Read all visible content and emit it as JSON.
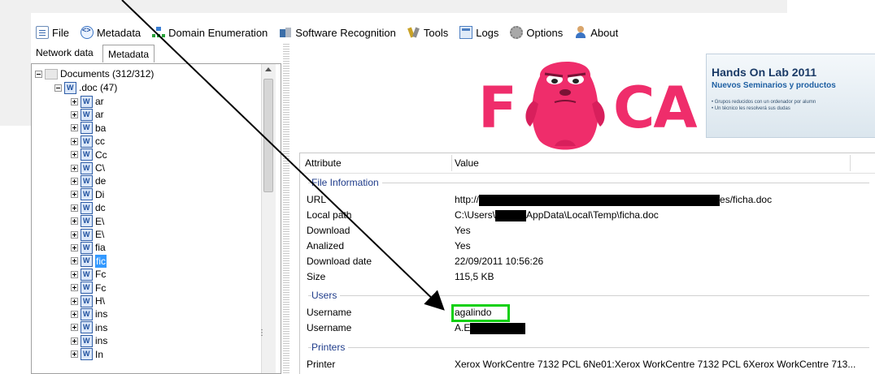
{
  "menu": [
    {
      "label": "File",
      "icon": "file-icon"
    },
    {
      "label": "Metadata",
      "icon": "metadata-icon"
    },
    {
      "label": "Domain Enumeration",
      "icon": "network-icon"
    },
    {
      "label": "Software Recognition",
      "icon": "software-icon"
    },
    {
      "label": "Tools",
      "icon": "tools-icon"
    },
    {
      "label": "Logs",
      "icon": "logs-icon"
    },
    {
      "label": "Options",
      "icon": "gear-icon"
    },
    {
      "label": "About",
      "icon": "user-icon"
    }
  ],
  "tabs": {
    "network": "Network data",
    "metadata": "Metadata"
  },
  "tree": {
    "root": "Documents (312/312)",
    "doc_group": ".doc (47)",
    "items": [
      "ar",
      "ar",
      "ba",
      "cc",
      "Cc",
      "C\\",
      "de",
      "Di",
      "dc",
      "E\\",
      "E\\",
      "fia",
      "fic",
      "Fc",
      "Fc",
      "H\\",
      "ins",
      "ins",
      "ins",
      "In"
    ],
    "selected_index": 12
  },
  "logo": {
    "text_left": "F",
    "text_right": "CA",
    "colors": {
      "brand": "#ef2d6b"
    }
  },
  "banner": {
    "title": "Hands On Lab 2011",
    "subtitle": "Nuevos Seminarios y productos",
    "bullet1": "• Grupos reducidos con un ordenador por alumn",
    "bullet2": "• Un técnico les resolverá sus dudas"
  },
  "grid": {
    "headers": {
      "attribute": "Attribute",
      "value": "Value"
    },
    "groups": {
      "file": "File Information",
      "users": "Users",
      "printers": "Printers"
    },
    "file_rows": [
      {
        "attr": "URL",
        "prefix": "http://",
        "suffix": "es/ficha.doc"
      },
      {
        "attr": "Local path",
        "prefix": "C:\\Users\\",
        "suffix": "AppData\\Local\\Temp\\ficha.doc"
      },
      {
        "attr": "Download",
        "value": "Yes"
      },
      {
        "attr": "Analized",
        "value": "Yes"
      },
      {
        "attr": "Download date",
        "value": "22/09/2011 10:56:26"
      },
      {
        "attr": "Size",
        "value": "115,5 KB"
      }
    ],
    "user_rows": [
      {
        "attr": "Username",
        "value": "agalindo"
      },
      {
        "attr": "Username",
        "prefix": "A.E"
      }
    ],
    "printer_rows": [
      {
        "attr": "Printer",
        "value": "Xerox WorkCentre 7132 PCL 6Ne01:Xerox WorkCentre 7132 PCL 6Xerox WorkCentre 713..."
      }
    ]
  },
  "colors": {
    "highlight": "#10d010",
    "group_text": "#1e3b8a",
    "selection": "#3399ff"
  }
}
